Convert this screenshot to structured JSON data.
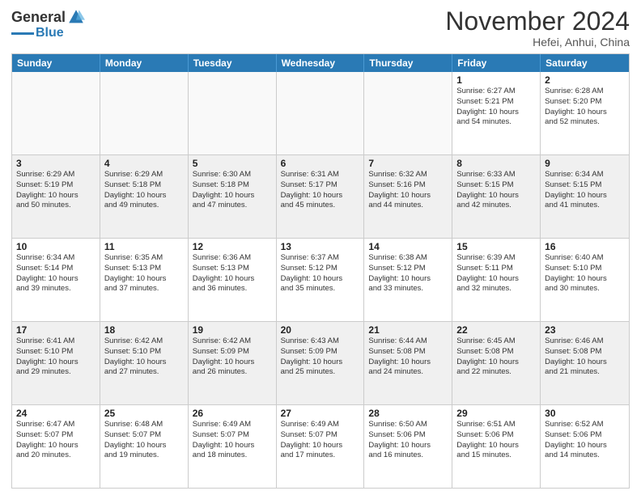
{
  "logo": {
    "general": "General",
    "blue": "Blue"
  },
  "title": "November 2024",
  "location": "Hefei, Anhui, China",
  "days_of_week": [
    "Sunday",
    "Monday",
    "Tuesday",
    "Wednesday",
    "Thursday",
    "Friday",
    "Saturday"
  ],
  "weeks": [
    [
      {
        "day": "",
        "info": "",
        "empty": true
      },
      {
        "day": "",
        "info": "",
        "empty": true
      },
      {
        "day": "",
        "info": "",
        "empty": true
      },
      {
        "day": "",
        "info": "",
        "empty": true
      },
      {
        "day": "",
        "info": "",
        "empty": true
      },
      {
        "day": "1",
        "info": "Sunrise: 6:27 AM\nSunset: 5:21 PM\nDaylight: 10 hours\nand 54 minutes."
      },
      {
        "day": "2",
        "info": "Sunrise: 6:28 AM\nSunset: 5:20 PM\nDaylight: 10 hours\nand 52 minutes."
      }
    ],
    [
      {
        "day": "3",
        "info": "Sunrise: 6:29 AM\nSunset: 5:19 PM\nDaylight: 10 hours\nand 50 minutes."
      },
      {
        "day": "4",
        "info": "Sunrise: 6:29 AM\nSunset: 5:18 PM\nDaylight: 10 hours\nand 49 minutes."
      },
      {
        "day": "5",
        "info": "Sunrise: 6:30 AM\nSunset: 5:18 PM\nDaylight: 10 hours\nand 47 minutes."
      },
      {
        "day": "6",
        "info": "Sunrise: 6:31 AM\nSunset: 5:17 PM\nDaylight: 10 hours\nand 45 minutes."
      },
      {
        "day": "7",
        "info": "Sunrise: 6:32 AM\nSunset: 5:16 PM\nDaylight: 10 hours\nand 44 minutes."
      },
      {
        "day": "8",
        "info": "Sunrise: 6:33 AM\nSunset: 5:15 PM\nDaylight: 10 hours\nand 42 minutes."
      },
      {
        "day": "9",
        "info": "Sunrise: 6:34 AM\nSunset: 5:15 PM\nDaylight: 10 hours\nand 41 minutes."
      }
    ],
    [
      {
        "day": "10",
        "info": "Sunrise: 6:34 AM\nSunset: 5:14 PM\nDaylight: 10 hours\nand 39 minutes."
      },
      {
        "day": "11",
        "info": "Sunrise: 6:35 AM\nSunset: 5:13 PM\nDaylight: 10 hours\nand 37 minutes."
      },
      {
        "day": "12",
        "info": "Sunrise: 6:36 AM\nSunset: 5:13 PM\nDaylight: 10 hours\nand 36 minutes."
      },
      {
        "day": "13",
        "info": "Sunrise: 6:37 AM\nSunset: 5:12 PM\nDaylight: 10 hours\nand 35 minutes."
      },
      {
        "day": "14",
        "info": "Sunrise: 6:38 AM\nSunset: 5:12 PM\nDaylight: 10 hours\nand 33 minutes."
      },
      {
        "day": "15",
        "info": "Sunrise: 6:39 AM\nSunset: 5:11 PM\nDaylight: 10 hours\nand 32 minutes."
      },
      {
        "day": "16",
        "info": "Sunrise: 6:40 AM\nSunset: 5:10 PM\nDaylight: 10 hours\nand 30 minutes."
      }
    ],
    [
      {
        "day": "17",
        "info": "Sunrise: 6:41 AM\nSunset: 5:10 PM\nDaylight: 10 hours\nand 29 minutes."
      },
      {
        "day": "18",
        "info": "Sunrise: 6:42 AM\nSunset: 5:10 PM\nDaylight: 10 hours\nand 27 minutes."
      },
      {
        "day": "19",
        "info": "Sunrise: 6:42 AM\nSunset: 5:09 PM\nDaylight: 10 hours\nand 26 minutes."
      },
      {
        "day": "20",
        "info": "Sunrise: 6:43 AM\nSunset: 5:09 PM\nDaylight: 10 hours\nand 25 minutes."
      },
      {
        "day": "21",
        "info": "Sunrise: 6:44 AM\nSunset: 5:08 PM\nDaylight: 10 hours\nand 24 minutes."
      },
      {
        "day": "22",
        "info": "Sunrise: 6:45 AM\nSunset: 5:08 PM\nDaylight: 10 hours\nand 22 minutes."
      },
      {
        "day": "23",
        "info": "Sunrise: 6:46 AM\nSunset: 5:08 PM\nDaylight: 10 hours\nand 21 minutes."
      }
    ],
    [
      {
        "day": "24",
        "info": "Sunrise: 6:47 AM\nSunset: 5:07 PM\nDaylight: 10 hours\nand 20 minutes."
      },
      {
        "day": "25",
        "info": "Sunrise: 6:48 AM\nSunset: 5:07 PM\nDaylight: 10 hours\nand 19 minutes."
      },
      {
        "day": "26",
        "info": "Sunrise: 6:49 AM\nSunset: 5:07 PM\nDaylight: 10 hours\nand 18 minutes."
      },
      {
        "day": "27",
        "info": "Sunrise: 6:49 AM\nSunset: 5:07 PM\nDaylight: 10 hours\nand 17 minutes."
      },
      {
        "day": "28",
        "info": "Sunrise: 6:50 AM\nSunset: 5:06 PM\nDaylight: 10 hours\nand 16 minutes."
      },
      {
        "day": "29",
        "info": "Sunrise: 6:51 AM\nSunset: 5:06 PM\nDaylight: 10 hours\nand 15 minutes."
      },
      {
        "day": "30",
        "info": "Sunrise: 6:52 AM\nSunset: 5:06 PM\nDaylight: 10 hours\nand 14 minutes."
      }
    ]
  ]
}
